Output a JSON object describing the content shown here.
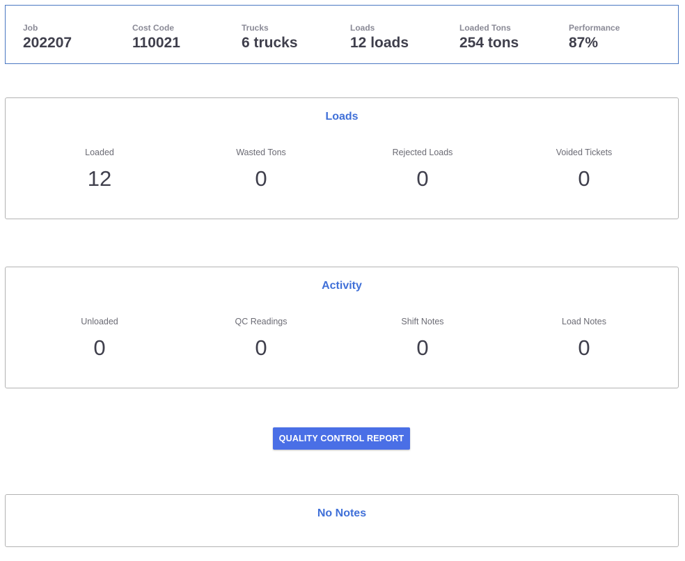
{
  "summary": {
    "job": {
      "label": "Job",
      "value": "202207"
    },
    "cost_code": {
      "label": "Cost Code",
      "value": "110021"
    },
    "trucks": {
      "label": "Trucks",
      "value": "6 trucks"
    },
    "loads": {
      "label": "Loads",
      "value": "12 loads"
    },
    "loaded_tons": {
      "label": "Loaded Tons",
      "value": "254 tons"
    },
    "performance": {
      "label": "Performance",
      "value": "87%"
    }
  },
  "loads_card": {
    "title": "Loads",
    "stats": [
      {
        "label": "Loaded",
        "value": "12"
      },
      {
        "label": "Wasted Tons",
        "value": "0"
      },
      {
        "label": "Rejected Loads",
        "value": "0"
      },
      {
        "label": "Voided Tickets",
        "value": "0"
      }
    ]
  },
  "activity_card": {
    "title": "Activity",
    "stats": [
      {
        "label": "Unloaded",
        "value": "0"
      },
      {
        "label": "QC Readings",
        "value": "0"
      },
      {
        "label": "Shift Notes",
        "value": "0"
      },
      {
        "label": "Load Notes",
        "value": "0"
      }
    ]
  },
  "qc_button_label": "QUALITY CONTROL REPORT",
  "notes_card": {
    "title": "No Notes"
  },
  "colors": {
    "accent": "#4070d8",
    "button": "#4a6fe6",
    "summary_border": "#4a78c2"
  }
}
